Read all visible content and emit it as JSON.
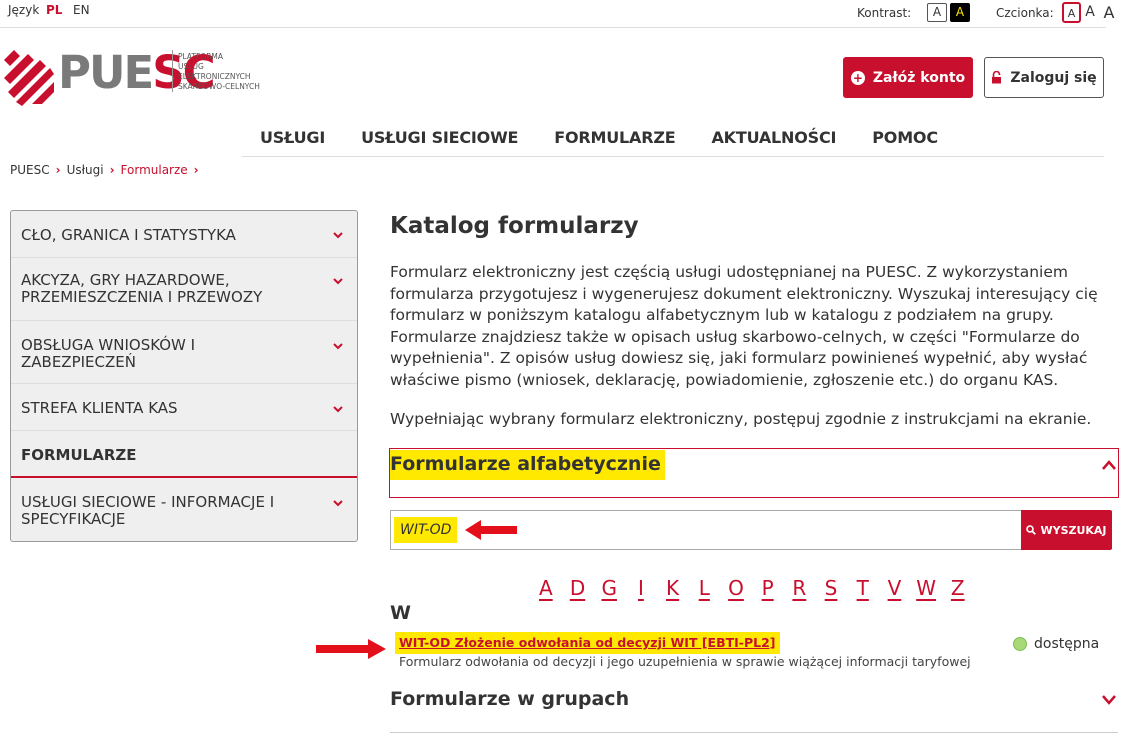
{
  "topbar": {
    "lang_label": "Język",
    "lang_pl": "PL",
    "lang_en": "EN",
    "contrast_label": "Kontrast:",
    "contrast_normal": "A",
    "contrast_high": "A",
    "font_label": "Czcionka:",
    "font_small": "A",
    "font_medium": "A",
    "font_large": "A"
  },
  "logo": {
    "word_pu": "PUE",
    "word_sc": "SC",
    "subtitle": "PLATFORMA\nUSŁUG\nELEKTRONICZNYCH\nSKARBOWO-CELNYCH"
  },
  "account": {
    "register_label": "Załóż konto",
    "register_icon": "plus-icon",
    "login_label": "Zaloguj się",
    "login_icon": "lock-icon"
  },
  "mainnav": [
    "USŁUGI",
    "USŁUGI SIECIOWE",
    "FORMULARZE",
    "AKTUALNOŚCI",
    "POMOC"
  ],
  "breadcrumb": [
    "PUESC",
    "Usługi",
    "Formularze"
  ],
  "sidebar": {
    "items": [
      {
        "label": "CŁO, GRANICA I STATYSTYKA"
      },
      {
        "label": "AKCYZA, GRY HAZARDOWE, PRZEMIESZCZENIA I PRZEWOZY"
      },
      {
        "label": "OBSŁUGA WNIOSKÓW I ZABEZPIECZEŃ"
      },
      {
        "label": "STREFA KLIENTA KAS"
      },
      {
        "label": "FORMULARZE"
      },
      {
        "label": "USŁUGI SIECIOWE - INFORMACJE I SPECYFIKACJE"
      }
    ]
  },
  "main": {
    "title": "Katalog formularzy",
    "intro": "Formularz elektroniczny jest częścią usługi udostępnianej na PUESC. Z wykorzystaniem formularza przygotujesz i wygenerujesz dokument elektroniczny. Wyszukaj interesujący cię formularz w poniższym katalogu alfabetycznym lub w katalogu z podziałem na grupy. Formularze znajdziesz także w opisach usług skarbowo-celnych, w części \"Formularze do wypełnienia\". Z opisów usług dowiesz się, jaki formularz powinieneś wypełnić, aby wysłać właściwe pismo (wniosek, deklarację, powiadomienie, zgłoszenie etc.) do organu KAS.",
    "intro2": "Wypełniając wybrany formularz elektroniczny, postępuj zgodnie z instrukcjami na ekranie.",
    "alpha_title": "Formularze alfabetycznie",
    "search_value": "WIT-OD",
    "search_button": "WYSZUKAJ",
    "letters": [
      "A",
      "D",
      "G",
      "I",
      "K",
      "L",
      "O",
      "P",
      "R",
      "S",
      "T",
      "V",
      "W",
      "Z"
    ],
    "group_letter": "W",
    "result": {
      "title": "WIT-OD Złożenie odwołania od decyzji WIT [EBTI-PL2]",
      "description": "Formularz odwołania od decyzji i jego uzupełnienia w sprawie wiążącej informacji taryfowej",
      "status": "dostępna"
    },
    "groups_title": "Formularze w grupach"
  },
  "colors": {
    "brand": "#c8102e",
    "highlight": "#ffe900",
    "status_ok": "#a8d878"
  }
}
